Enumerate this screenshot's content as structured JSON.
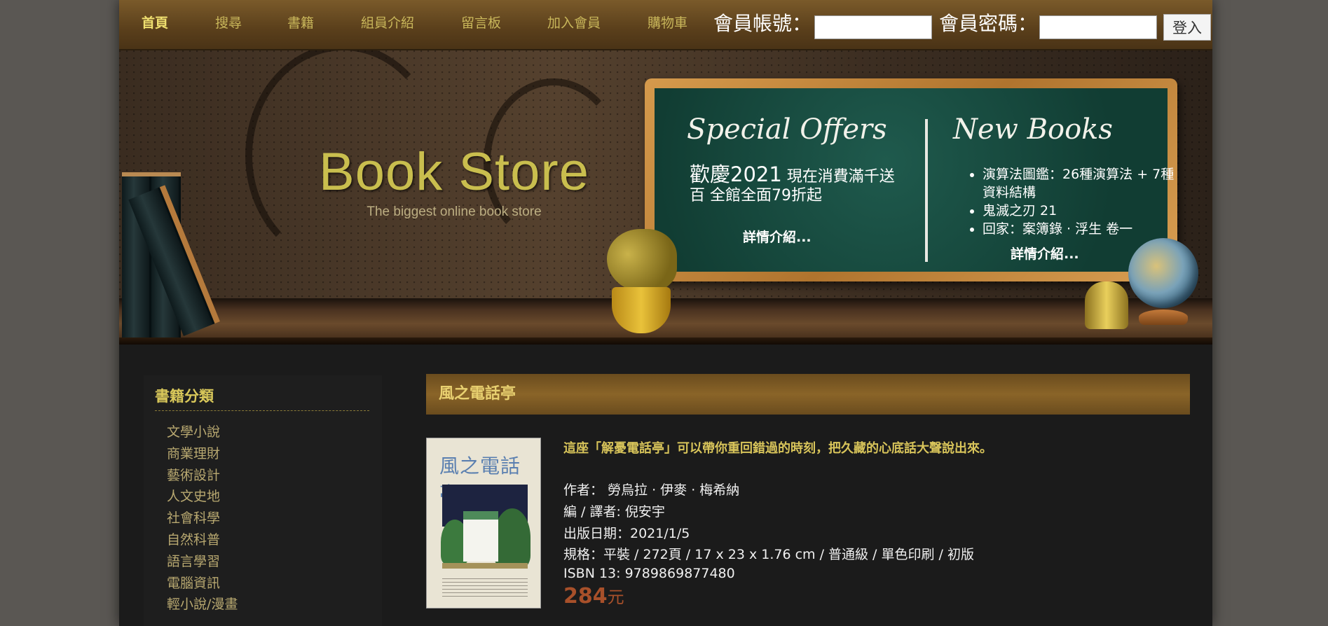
{
  "nav": {
    "items": [
      {
        "label": "首頁",
        "active": true
      },
      {
        "label": "搜尋"
      },
      {
        "label": "書籍"
      },
      {
        "label": "組員介紹"
      },
      {
        "label": "留言板"
      },
      {
        "label": "加入會員"
      },
      {
        "label": "購物車"
      }
    ]
  },
  "login": {
    "account_label": "會員帳號：",
    "account_value": "",
    "password_label": "會員密碼：",
    "password_value": "",
    "submit_label": "登入"
  },
  "banner": {
    "brand_title": "Book Store",
    "brand_subtitle": "The biggest online book store",
    "special": {
      "heading": "Special Offers",
      "text_big": "歡慶2021",
      "text_rest": " 現在消費滿千送百 全館全面79折起",
      "detail_link": "詳情介紹..."
    },
    "new_books": {
      "heading": "New Books",
      "items": [
        "演算法圖鑑：26種演算法 + 7種資料結構",
        "鬼滅之刃 21",
        "回家：案簿錄 · 浮生 卷一"
      ],
      "detail_link": "詳情介紹..."
    }
  },
  "sidebar": {
    "title": "書籍分類",
    "categories": [
      "文學小說",
      "商業理財",
      "藝術設計",
      "人文史地",
      "社會科學",
      "自然科普",
      "語言學習",
      "電腦資訊",
      "輕小說/漫畫"
    ]
  },
  "product": {
    "title": "風之電話亭",
    "cover_title": "風之電話亭",
    "tagline": "這座「解憂電話亭」可以帶你重回錯過的時刻，把久藏的心底話大聲說出來。",
    "author": "作者： 勞烏拉 · 伊麥 · 梅希納",
    "translator": "編 / 譯者: 倪安宇",
    "publish_date": "出版日期：2021/1/5",
    "spec": "規格：平裝 / 272頁 / 17 x 23 x 1.76 cm / 普通級 / 單色印刷 / 初版",
    "isbn": "ISBN 13: 9789869877480",
    "price_value": "284",
    "price_unit": "元"
  },
  "colors": {
    "accent_gold": "#d9c85a",
    "price": "#a8502a",
    "board_green": "#1f5a4d"
  }
}
